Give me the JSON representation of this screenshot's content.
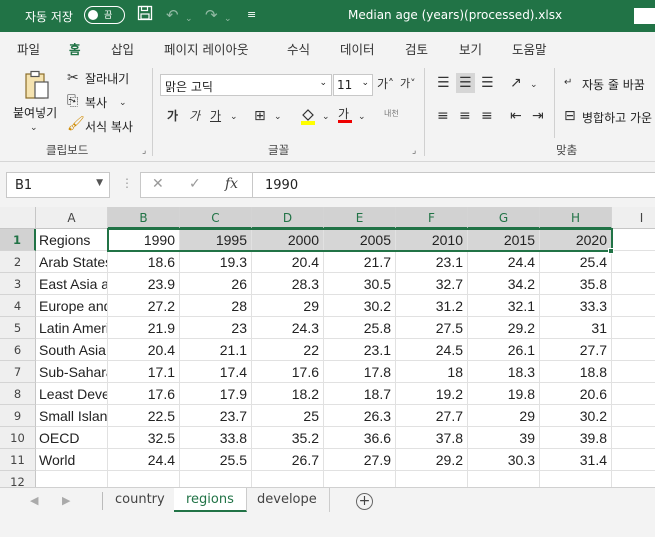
{
  "title_bar": {
    "autosave_label": "자동 저장",
    "autosave_state": "끔",
    "filename": "Median age (years)(processed).xlsx",
    "accent_color": "#217346"
  },
  "ribbon_tabs": [
    "파일",
    "홈",
    "삽입",
    "페이지 레이아웃",
    "수식",
    "데이터",
    "검토",
    "보기",
    "도움말"
  ],
  "active_tab": "홈",
  "ribbon": {
    "clipboard": {
      "paste": "붙여넣기",
      "cut": "잘라내기",
      "copy": "복사",
      "format_painter": "서식 복사",
      "group_label": "클립보드"
    },
    "font": {
      "font_name": "맑은 고딕",
      "font_size": "11",
      "group_label": "글꼴"
    },
    "alignment": {
      "wrap_text": "자동 줄 바꿈",
      "merge_center": "병합하고 가운",
      "group_label": "맞춤"
    }
  },
  "formula_bar": {
    "name_box": "B1",
    "cancel": "✕",
    "enter": "✓",
    "fx": "fx",
    "value": "1990"
  },
  "grid": {
    "columns": [
      "A",
      "B",
      "C",
      "D",
      "E",
      "F",
      "G",
      "H",
      "I"
    ],
    "row_numbers": [
      "1",
      "2",
      "3",
      "4",
      "5",
      "6",
      "7",
      "8",
      "9",
      "10",
      "11",
      "12"
    ],
    "header_row": [
      "Regions",
      "1990",
      "1995",
      "2000",
      "2005",
      "2010",
      "2015",
      "2020"
    ],
    "rows": [
      [
        "Arab States",
        "18.6",
        "19.3",
        "20.4",
        "21.7",
        "23.1",
        "24.4",
        "25.4"
      ],
      [
        "East Asia and the Pacific",
        "23.9",
        "26",
        "28.3",
        "30.5",
        "32.7",
        "34.2",
        "35.8"
      ],
      [
        "Europe and Central Asia",
        "27.2",
        "28",
        "29",
        "30.2",
        "31.2",
        "32.1",
        "33.3"
      ],
      [
        "Latin America and the Caribbean",
        "21.9",
        "23",
        "24.3",
        "25.8",
        "27.5",
        "29.2",
        "31"
      ],
      [
        "South Asia",
        "20.4",
        "21.1",
        "22",
        "23.1",
        "24.5",
        "26.1",
        "27.7"
      ],
      [
        "Sub-Saharan Africa",
        "17.1",
        "17.4",
        "17.6",
        "17.8",
        "18",
        "18.3",
        "18.8"
      ],
      [
        "Least Developed Countries",
        "17.6",
        "17.9",
        "18.2",
        "18.7",
        "19.2",
        "19.8",
        "20.6"
      ],
      [
        "Small Island Developing States",
        "22.5",
        "23.7",
        "25",
        "26.3",
        "27.7",
        "29",
        "30.2"
      ],
      [
        "OECD",
        "32.5",
        "33.8",
        "35.2",
        "36.6",
        "37.8",
        "39",
        "39.8"
      ],
      [
        "World",
        "24.4",
        "25.5",
        "26.7",
        "27.9",
        "29.2",
        "30.3",
        "31.4"
      ]
    ]
  },
  "sheets": [
    "country",
    "regions",
    "develope"
  ],
  "active_sheet": "regions"
}
